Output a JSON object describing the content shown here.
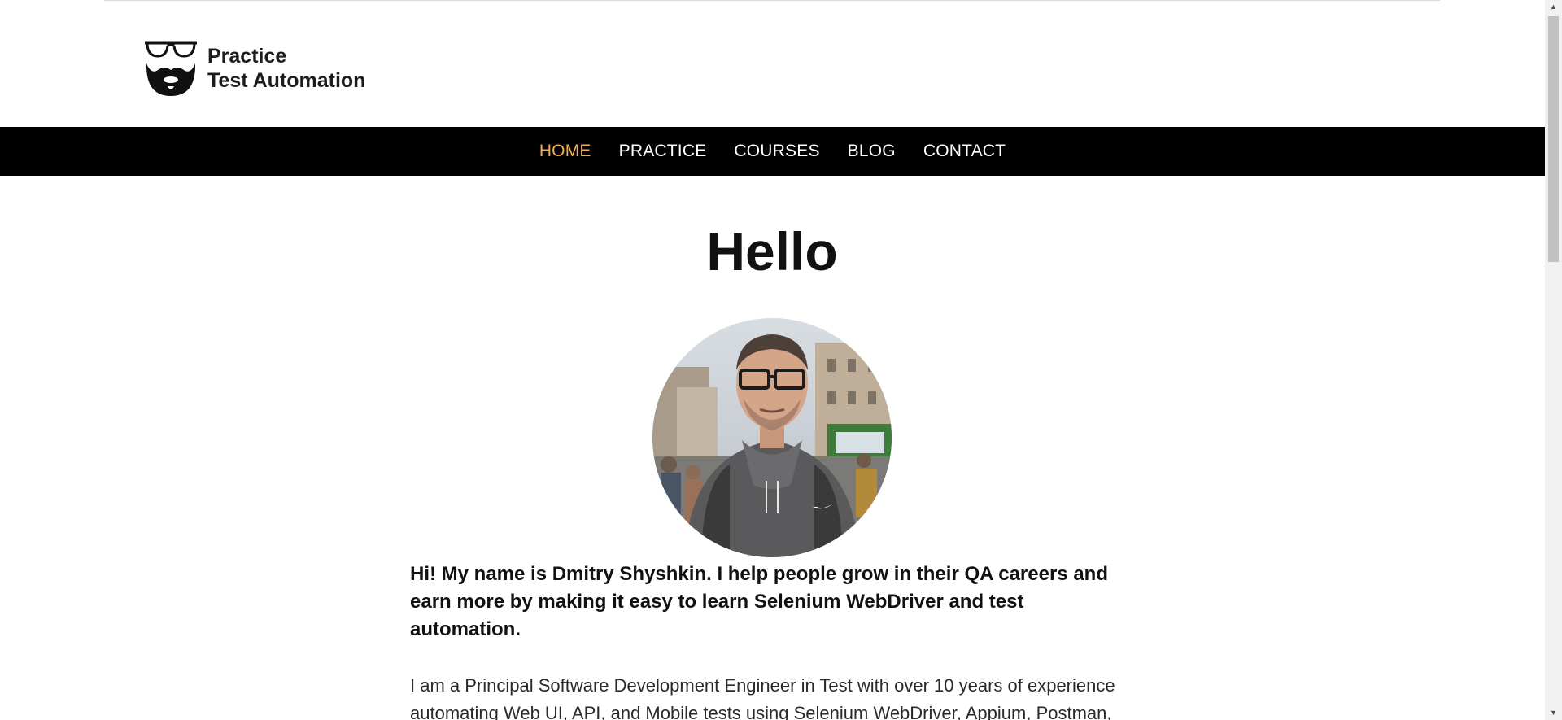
{
  "brand": {
    "line1": "Practice",
    "line2": "Test Automation",
    "logo_icon": "glasses-beard-icon"
  },
  "nav": {
    "items": [
      {
        "label": "HOME",
        "active": true
      },
      {
        "label": "PRACTICE",
        "active": false
      },
      {
        "label": "COURSES",
        "active": false
      },
      {
        "label": "BLOG",
        "active": false
      },
      {
        "label": "CONTACT",
        "active": false
      }
    ]
  },
  "main": {
    "heading": "Hello",
    "intro": "Hi! My name is Dmitry Shyshkin. I help people grow in their QA careers and earn more by making it easy to learn Selenium WebDriver and test automation.",
    "body": "I am a Principal Software Development Engineer in Test with over 10 years of experience automating Web UI, API, and Mobile tests using Selenium WebDriver, Appium, Postman,"
  },
  "colors": {
    "nav_bg": "#000000",
    "nav_active": "#f2ad4e",
    "nav_text": "#ffffff"
  }
}
